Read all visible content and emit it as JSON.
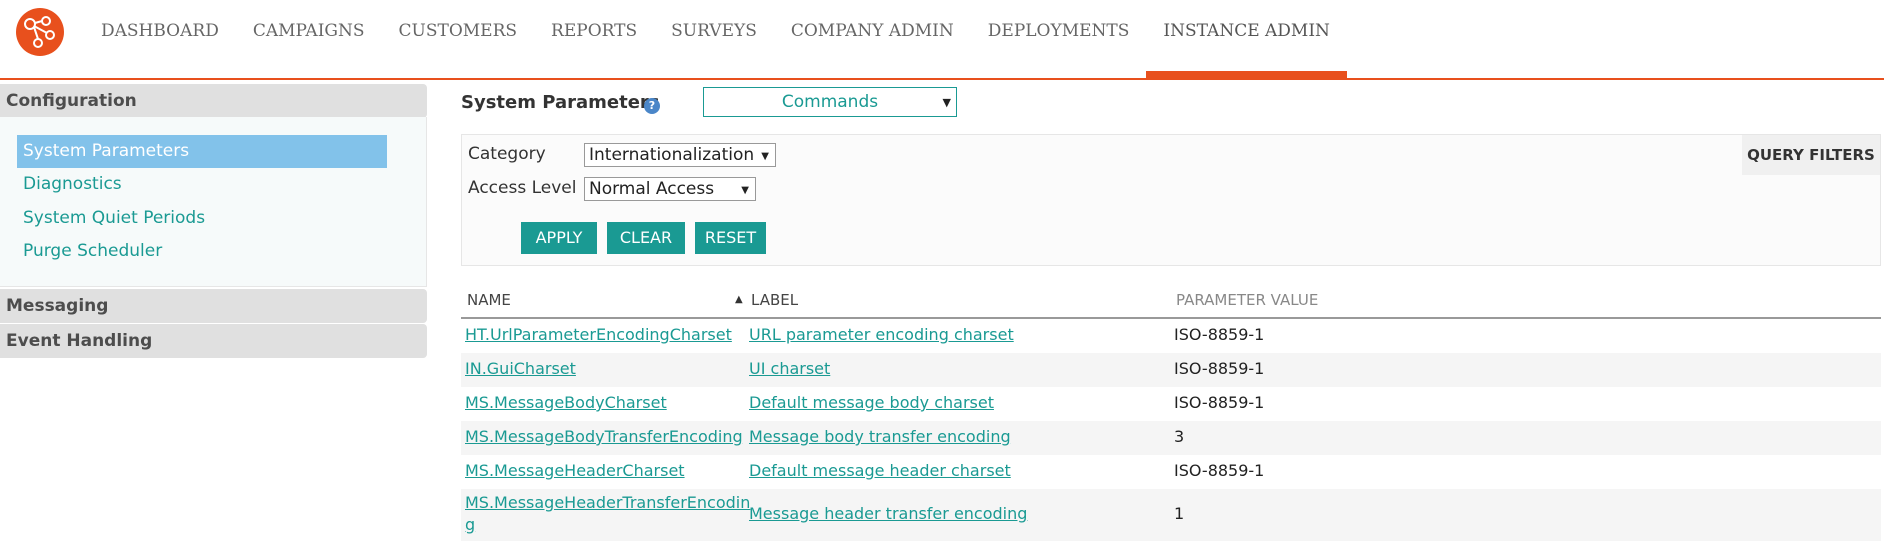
{
  "nav": {
    "items": [
      "DASHBOARD",
      "CAMPAIGNS",
      "CUSTOMERS",
      "REPORTS",
      "SURVEYS",
      "COMPANY ADMIN",
      "DEPLOYMENTS",
      "INSTANCE ADMIN"
    ],
    "active": "INSTANCE ADMIN"
  },
  "sidebar": {
    "configuration": "Configuration",
    "items": [
      "System Parameters",
      "Diagnostics",
      "System Quiet Periods",
      "Purge Scheduler"
    ],
    "messaging": "Messaging",
    "event_handling": "Event Handling"
  },
  "main": {
    "title": "System Parameters",
    "help": "?",
    "commands": "Commands",
    "filters": {
      "category_label": "Category",
      "category_value": "Internationalization",
      "access_label": "Access Level",
      "access_value": "Normal Access",
      "apply": "APPLY",
      "clear": "CLEAR",
      "reset": "RESET",
      "query_filters": "QUERY FILTERS"
    },
    "table": {
      "headers": {
        "name": "NAME",
        "label": "LABEL",
        "value": "PARAMETER VALUE"
      },
      "rows": [
        {
          "name": "HT.UrlParameterEncodingCharset",
          "label": "URL parameter encoding charset",
          "value": "ISO-8859-1"
        },
        {
          "name": "IN.GuiCharset",
          "label": "UI charset",
          "value": "ISO-8859-1"
        },
        {
          "name": "MS.MessageBodyCharset",
          "label": "Default message body charset",
          "value": "ISO-8859-1"
        },
        {
          "name": "MS.MessageBodyTransferEncoding",
          "label": "Message body transfer encoding",
          "value": "3"
        },
        {
          "name": "MS.MessageHeaderCharset",
          "label": "Default message header charset",
          "value": "ISO-8859-1"
        },
        {
          "name_line1": "MS.MessageHeaderTransferEncodin",
          "name_line2": "g",
          "label": "Message header transfer encoding",
          "value": "1"
        }
      ]
    }
  }
}
